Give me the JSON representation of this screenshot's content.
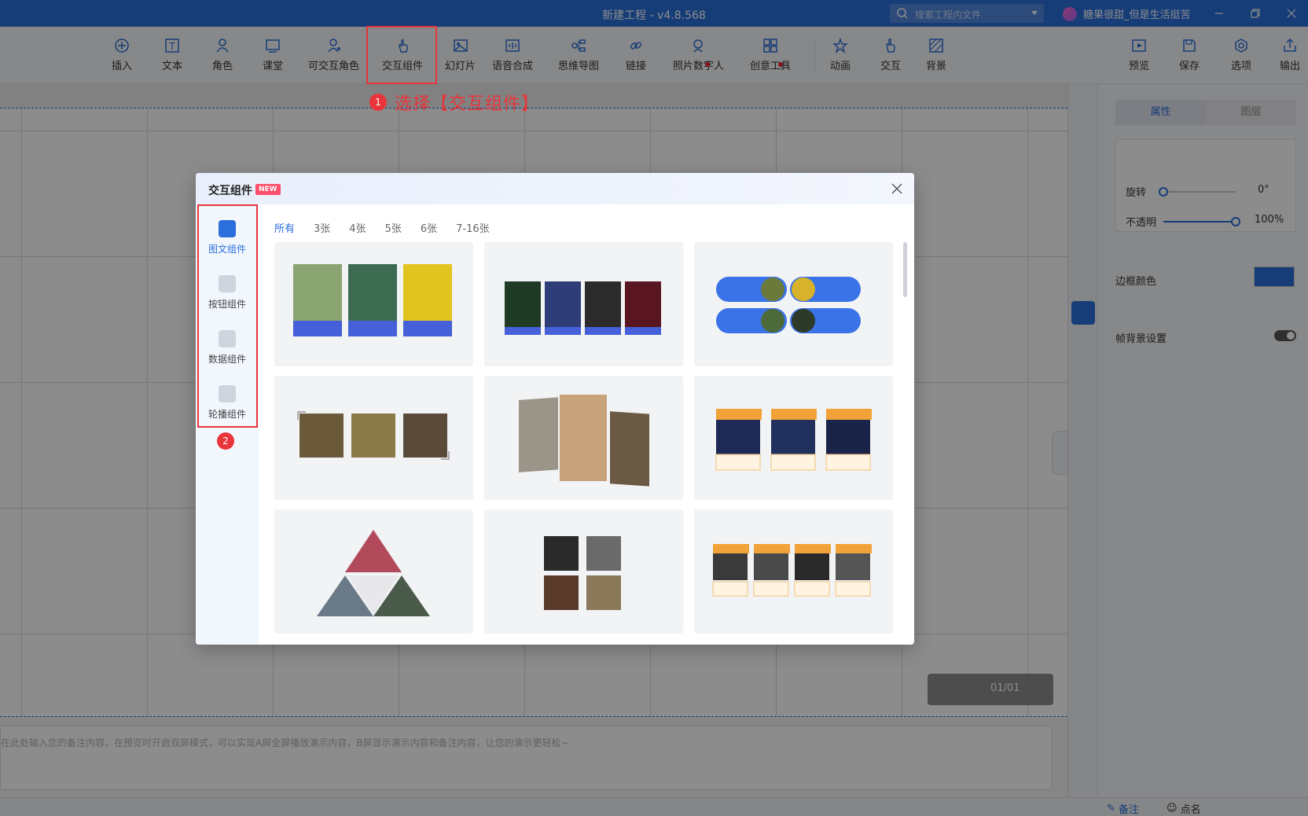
{
  "window": {
    "title": "新建工程 - v4.8.568",
    "search_placeholder": "搜索工程内文件",
    "username": "糖果很甜_但是生活挺苦"
  },
  "toolbar": {
    "items": [
      {
        "label": "插入",
        "icon": "plus-circle-icon"
      },
      {
        "label": "文本",
        "icon": "text-icon"
      },
      {
        "label": "角色",
        "icon": "person-icon"
      },
      {
        "label": "课堂",
        "icon": "classroom-icon"
      },
      {
        "label": "可交互角色",
        "icon": "interactive-person-icon"
      },
      {
        "label": "交互组件",
        "icon": "hand-click-icon"
      },
      {
        "label": "幻灯片",
        "icon": "image-icon"
      },
      {
        "label": "语音合成",
        "icon": "waveform-icon"
      },
      {
        "label": "思维导图",
        "icon": "mindmap-icon"
      },
      {
        "label": "链接",
        "icon": "link-icon"
      },
      {
        "label": "照片数字人",
        "icon": "digital-human-icon"
      },
      {
        "label": "创意工具",
        "icon": "grid-tools-icon"
      },
      {
        "label": "动画",
        "icon": "star-motion-icon"
      },
      {
        "label": "交互",
        "icon": "hand-icon"
      },
      {
        "label": "背景",
        "icon": "background-icon"
      }
    ],
    "right_items": [
      {
        "label": "预览",
        "icon": "play-icon"
      },
      {
        "label": "保存",
        "icon": "save-icon"
      },
      {
        "label": "选项",
        "icon": "settings-icon"
      },
      {
        "label": "输出",
        "icon": "export-icon"
      }
    ]
  },
  "annotations": {
    "step1_number": "1",
    "step1_text": "选择【交互组件】",
    "step2_number": "2"
  },
  "notes": {
    "placeholder": "在此处输入您的备注内容，在预览时开启双屏模式，可以实现A屏全屏播放演示内容，B屏显示演示内容和备注内容，让您的演示更轻松~"
  },
  "pager": {
    "label": "01/01"
  },
  "properties": {
    "tabs": [
      "属性",
      "图层"
    ],
    "rotate_label": "旋转",
    "rotate_value": "0°",
    "rotate_level": 0.0,
    "opacity_label": "不透明",
    "opacity_value": "100%",
    "opacity_level": 1.0,
    "border_color_label": "边框颜色",
    "border_color": "#2a6fdb",
    "frame_bg_label": "帧背景设置"
  },
  "statusbar": {
    "notes_label": "备注",
    "rollcall_label": "点名"
  },
  "modal": {
    "title": "交互组件",
    "badge": "NEW",
    "sidebar": [
      {
        "label": "图文组件",
        "icon": "image-text-icon",
        "active": true
      },
      {
        "label": "按钮组件",
        "icon": "button-icon",
        "active": false
      },
      {
        "label": "数据组件",
        "icon": "data-cube-icon",
        "active": false
      },
      {
        "label": "轮播组件",
        "icon": "carousel-icon",
        "active": false
      }
    ],
    "filters": [
      "所有",
      "3张",
      "4张",
      "5张",
      "6张",
      "7-16张"
    ],
    "active_filter": "所有",
    "cards": [
      {
        "name": "three-portrait-cards"
      },
      {
        "name": "four-floral-cards"
      },
      {
        "name": "blue-pill-cards"
      },
      {
        "name": "three-food-frames"
      },
      {
        "name": "stacked-photo-carousel"
      },
      {
        "name": "three-night-sky-cards"
      },
      {
        "name": "triangle-mosaic"
      },
      {
        "name": "four-coffee-frames"
      },
      {
        "name": "four-mountain-cards"
      }
    ]
  },
  "colors": {
    "accent": "#2a6fdb",
    "highlight": "#e8353b",
    "new_badge": "#ff4d6a"
  }
}
